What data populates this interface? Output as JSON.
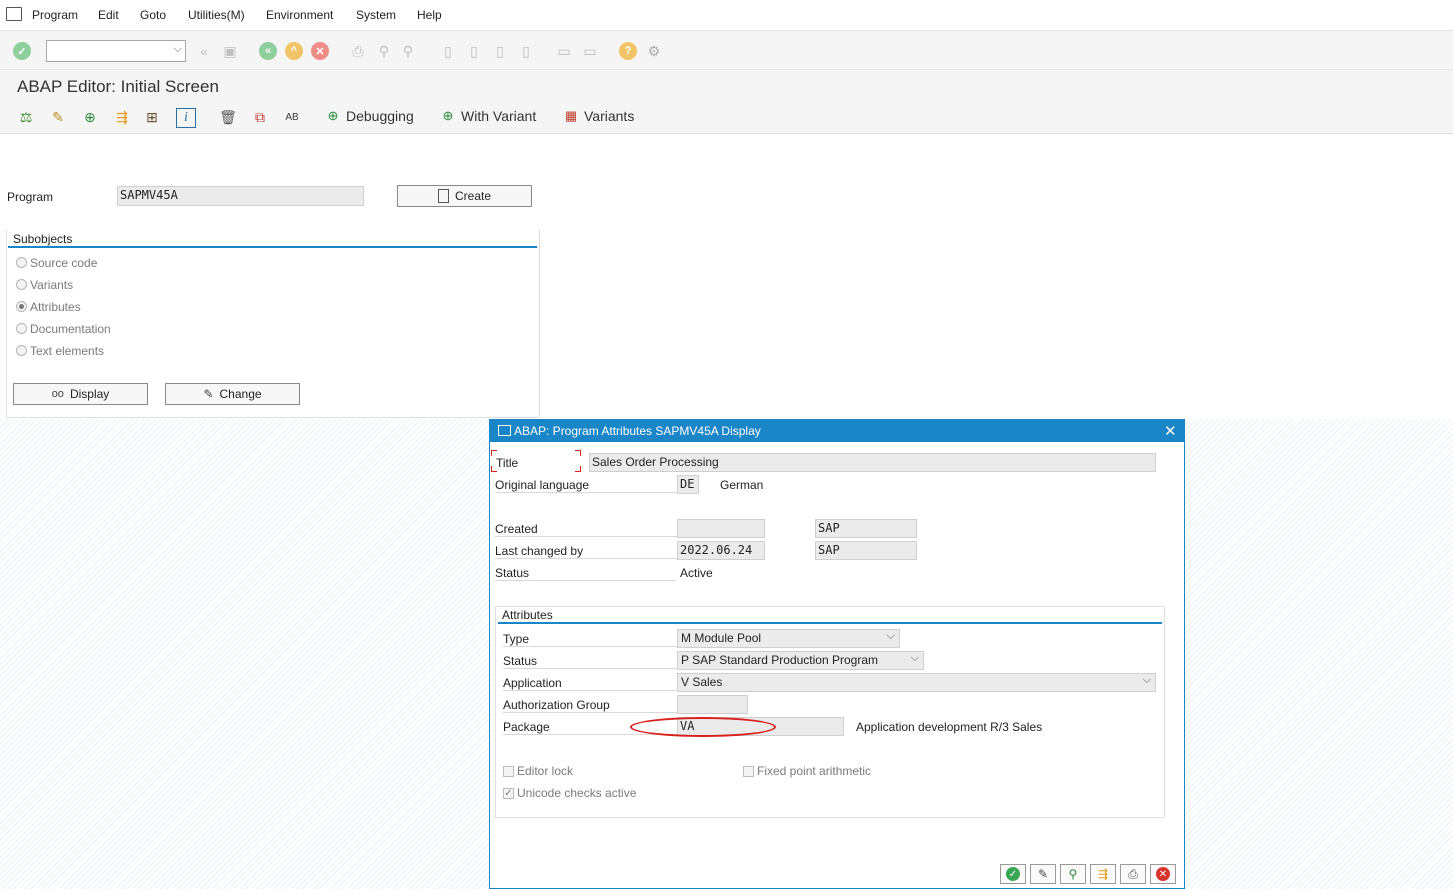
{
  "menu": [
    "Program",
    "Edit",
    "Goto",
    "Utilities(M)",
    "Environment",
    "System",
    "Help"
  ],
  "page_title": "ABAP Editor: Initial Screen",
  "app_toolbar": {
    "debugging_label": "Debugging",
    "with_variant_label": "With Variant",
    "variants_label": "Variants"
  },
  "main": {
    "program_label": "Program",
    "program_value": "SAPMV45A",
    "create_label": "Create",
    "subobjects_title": "Subobjects",
    "subobjects": [
      {
        "label": "Source code",
        "selected": false
      },
      {
        "label": "Variants",
        "selected": false
      },
      {
        "label": "Attributes",
        "selected": true
      },
      {
        "label": "Documentation",
        "selected": false
      },
      {
        "label": "Text elements",
        "selected": false
      }
    ],
    "display_label": "Display",
    "change_label": "Change"
  },
  "dialog": {
    "title": "ABAP: Program Attributes SAPMV45A Display",
    "title_label": "Title",
    "title_value": "Sales Order Processing",
    "orig_lang_label": "Original language",
    "orig_lang_code": "DE",
    "orig_lang_name": "German",
    "created_label": "Created",
    "created_date": "",
    "created_by": "SAP",
    "last_changed_label": "Last changed by",
    "last_changed_date": "2022.06.24",
    "last_changed_by": "SAP",
    "status_label": "Status",
    "status_value": "Active",
    "attributes_title": "Attributes",
    "type_label": "Type",
    "type_value": "M Module Pool",
    "status2_label": "Status",
    "status2_value": "P SAP Standard Production Program",
    "application_label": "Application",
    "application_value": "V Sales",
    "auth_group_label": "Authorization Group",
    "auth_group_value": "",
    "package_label": "Package",
    "package_value": "VA",
    "package_desc": "Application development R/3 Sales",
    "editor_lock_label": "Editor lock",
    "editor_lock_checked": false,
    "fixed_point_label": "Fixed point arithmetic",
    "fixed_point_checked": false,
    "unicode_label": "Unicode checks active",
    "unicode_checked": true
  },
  "colors": {
    "accent": "#1a86c8",
    "ok_green": "#3aa655",
    "cancel_red": "#d9342b",
    "highlight_ellipse": "#d8201c"
  }
}
